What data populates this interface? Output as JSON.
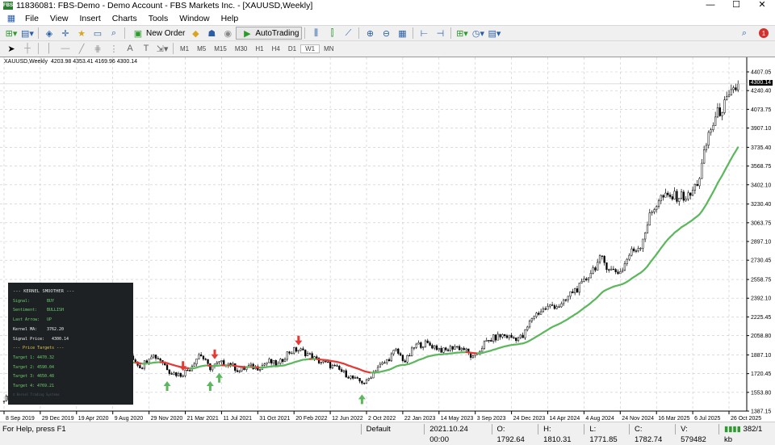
{
  "window": {
    "title": "11836081: FBS-Demo - Demo Account - FBS Markets Inc. - [XAUUSD,Weekly]",
    "logo": "FBS",
    "controls": [
      "—",
      "☐",
      "✕"
    ]
  },
  "menu": [
    "File",
    "View",
    "Insert",
    "Charts",
    "Tools",
    "Window",
    "Help"
  ],
  "toolbar": {
    "new_order": "New Order",
    "autotrading": "AutoTrading",
    "notification_count": "1"
  },
  "timeframes": [
    "M1",
    "M5",
    "M15",
    "M30",
    "H1",
    "H4",
    "D1",
    "W1",
    "MN"
  ],
  "selected_timeframe": "W1",
  "symbol_line": {
    "symbol": "XAUUSD,Weekly",
    "ohlc": "4203.98 4353.41 4169.96 4300.14"
  },
  "current_price": "4300.14",
  "panel": {
    "title": "--- KERNEL SMOOTHER ---",
    "rows": [
      {
        "k": "Signal:",
        "v": "BUY"
      },
      {
        "k": "Sentiment:",
        "v": "BULLISH"
      },
      {
        "k": "Last Arrow:",
        "v": "UP"
      },
      {
        "k": "Kernel MA:",
        "v": "3762.20"
      },
      {
        "k": "Signal Price:",
        "v": "4300.14"
      }
    ],
    "targets_title": "--- Price Targets ---",
    "targets": [
      {
        "k": "Target 1:",
        "v": "4470.32"
      },
      {
        "k": "Target 2:",
        "v": "4590.04"
      },
      {
        "k": "Target 3:",
        "v": "4650.48"
      },
      {
        "k": "Target 4:",
        "v": "4769.21"
      }
    ],
    "footer": "© Kernel Trading Systems"
  },
  "status": {
    "help": "For Help, press F1",
    "profile": "Default",
    "time": "2021.10.24 00:00",
    "open": "O: 1792.64",
    "high": "H: 1810.31",
    "low": "L: 1771.85",
    "close": "C: 1782.74",
    "volume": "V: 579482",
    "traffic": "382/1 kb"
  },
  "chart_data": {
    "type": "candlestick",
    "title": "XAUUSD,Weekly",
    "ylim": [
      1387.15,
      4407.05
    ],
    "price_ticks": [
      "4407.05",
      "4240.40",
      "4073.75",
      "3907.10",
      "3735.40",
      "3568.75",
      "3402.10",
      "3230.40",
      "3063.75",
      "2897.10",
      "2730.45",
      "2558.75",
      "2392.10",
      "2225.45",
      "2058.80",
      "1887.10",
      "1720.45",
      "1553.80",
      "1387.15"
    ],
    "date_ticks": [
      "8 Sep 2019",
      "29 Dec 2019",
      "19 Apr 2020",
      "9 Aug 2020",
      "29 Nov 2020",
      "21 Mar 2021",
      "11 Jul 2021",
      "31 Oct 2021",
      "20 Feb 2022",
      "12 Jun 2022",
      "2 Oct 2022",
      "22 Jan 2023",
      "14 May 2023",
      "3 Sep 2023",
      "24 Dec 2023",
      "14 Apr 2024",
      "4 Aug 2024",
      "24 Nov 2024",
      "16 Mar 2025",
      "6 Jul 2025",
      "26 Oct 2025"
    ],
    "monthly_closes_from_sep_2019": [
      1500,
      1513,
      1464,
      1517,
      1587,
      1585,
      1577,
      1686,
      1730,
      1781,
      1975,
      1967,
      1886,
      1879,
      1776,
      1895,
      1847,
      1734,
      1708,
      1769,
      1903,
      1770,
      1814,
      1813,
      1743,
      1783,
      1774,
      1829,
      1797,
      1909,
      1937,
      1897,
      1837,
      1807,
      1766,
      1711,
      1660,
      1640,
      1768,
      1824,
      1928,
      1827,
      1969,
      1990,
      1962,
      1919,
      1965,
      1940,
      1849,
      1984,
      2036,
      2063,
      2039,
      2044,
      2230,
      2286,
      2327,
      2326,
      2447,
      2503,
      2634,
      2744,
      2643,
      2625,
      2798,
      2858,
      3124,
      3289,
      3289,
      3303,
      3290,
      3448,
      3858,
      4050,
      4150,
      4300.14
    ],
    "kernel_ma_last": 3735.4,
    "arrows": [
      {
        "week": 49,
        "dir": "down"
      },
      {
        "week": 79,
        "dir": "down"
      },
      {
        "week": 93,
        "dir": "down"
      },
      {
        "week": 130,
        "dir": "down"
      },
      {
        "week": 72,
        "dir": "up"
      },
      {
        "week": 91,
        "dir": "up"
      },
      {
        "week": 95,
        "dir": "up"
      },
      {
        "week": 158,
        "dir": "up"
      }
    ],
    "colors": {
      "ma_up": "#5cb85c",
      "ma_down": "#e53935",
      "arrow_up": "#5cb85c",
      "arrow_down": "#e53935"
    }
  }
}
